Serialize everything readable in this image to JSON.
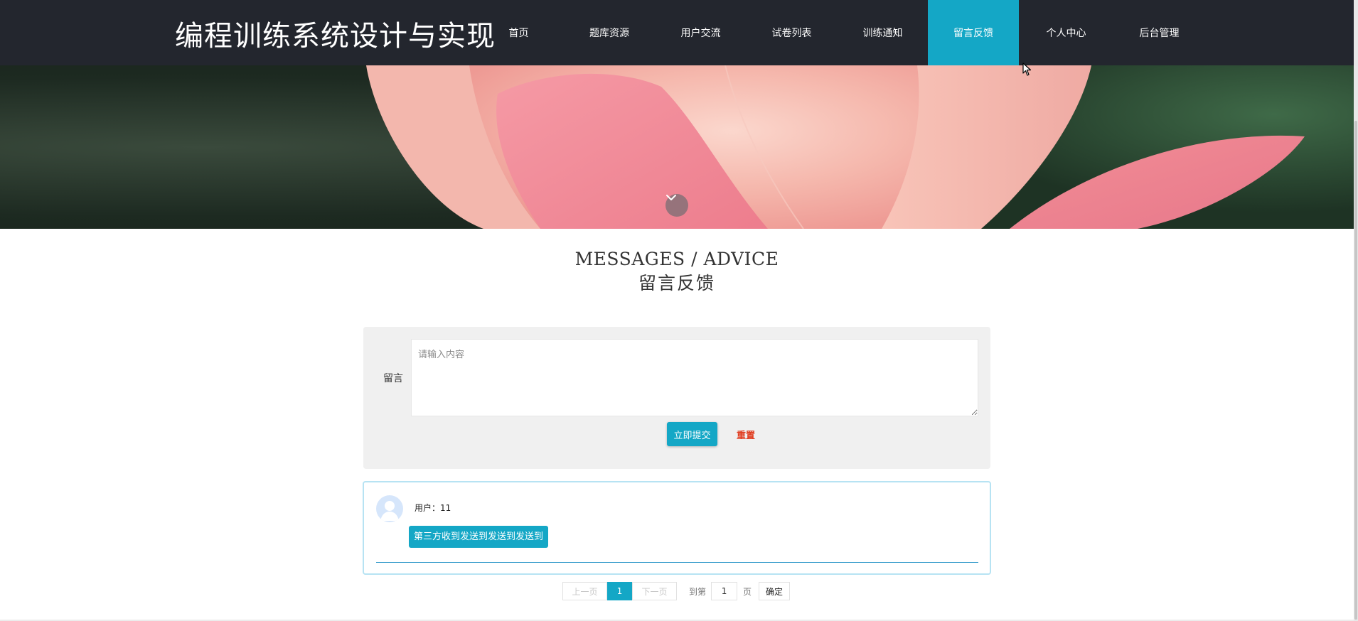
{
  "site": {
    "title": "编程训练系统设计与实现"
  },
  "nav": {
    "items": [
      {
        "label": "首页",
        "name": "nav-item-home"
      },
      {
        "label": "题库资源",
        "name": "nav-item-question-bank"
      },
      {
        "label": "用户交流",
        "name": "nav-item-user-forum"
      },
      {
        "label": "试卷列表",
        "name": "nav-item-exam-list"
      },
      {
        "label": "训练通知",
        "name": "nav-item-training-notice"
      },
      {
        "label": "留言反馈",
        "name": "nav-item-feedback"
      },
      {
        "label": "个人中心",
        "name": "nav-item-personal-center"
      },
      {
        "label": "后台管理",
        "name": "nav-item-admin"
      }
    ],
    "active_index": 5
  },
  "heading": {
    "en": "MESSAGES / ADVICE",
    "zh": "留言反馈"
  },
  "form": {
    "label": "留言",
    "placeholder": "请输入内容",
    "value": "",
    "submit_label": "立即提交",
    "reset_label": "重置"
  },
  "messages": [
    {
      "user_label": "用户：11",
      "content": "第三方收到发送到发送到发送到"
    }
  ],
  "pagination": {
    "prev_label": "上一页",
    "current_page": "1",
    "next_label": "下一页",
    "goto_label": "到第",
    "goto_value": "1",
    "unit_label": "页",
    "confirm_label": "确定"
  },
  "colors": {
    "navbar_bg": "#23262e",
    "accent": "#14a7c6",
    "reset_text": "#e03c1f",
    "panel_bg": "#f0f0f0"
  }
}
